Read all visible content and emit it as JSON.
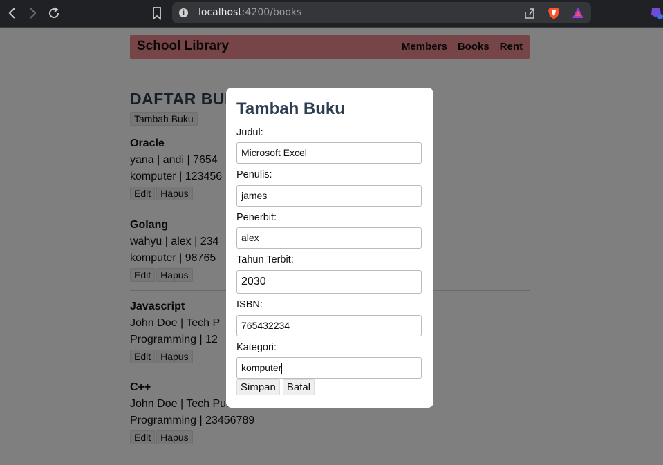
{
  "browser": {
    "url_host": "localhost",
    "url_path": ":4200/books"
  },
  "navbar": {
    "brand": "School Library",
    "links": [
      "Members",
      "Books",
      "Rent"
    ]
  },
  "page": {
    "heading": "DAFTAR BUKU",
    "add_button": "Tambah Buku",
    "books": [
      {
        "title": "Oracle",
        "line1": "yana | andi | 7654",
        "line2": "komputer | 123456",
        "edit": "Edit",
        "delete": "Hapus"
      },
      {
        "title": "Golang",
        "line1": "wahyu | alex | 234",
        "line2": "komputer | 98765",
        "edit": "Edit",
        "delete": "Hapus"
      },
      {
        "title": "Javascript",
        "line1": "John Doe | Tech P",
        "line2": "Programming | 12",
        "edit": "Edit",
        "delete": "Hapus"
      },
      {
        "title": "C++",
        "line1": "John Doe | Tech Pub",
        "line2": "Programming | 23456789",
        "edit": "Edit",
        "delete": "Hapus"
      }
    ]
  },
  "modal": {
    "title": "Tambah Buku",
    "fields": [
      {
        "label": "Judul:",
        "value": "Microsoft Excel"
      },
      {
        "label": "Penulis:",
        "value": "james"
      },
      {
        "label": "Penerbit:",
        "value": "alex"
      },
      {
        "label": "Tahun Terbit:",
        "value": "2030"
      },
      {
        "label": "ISBN:",
        "value": "765432234"
      },
      {
        "label": "Kategori:",
        "value": "komputer"
      }
    ],
    "save": "Simpan",
    "cancel": "Batal"
  },
  "colors": {
    "navbar_bg": "#ef8a8e",
    "heading": "#2c3e50",
    "overlay": "rgba(0,0,0,0.5)"
  }
}
